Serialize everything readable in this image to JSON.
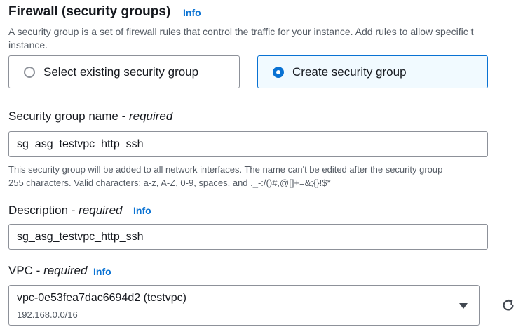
{
  "firewall": {
    "title": "Firewall (security groups)",
    "info": "Info",
    "description_line1": "A security group is a set of firewall rules that control the traffic for your instance. Add rules to allow specific t",
    "description_line2": "instance."
  },
  "options": {
    "existing_label": "Select existing security group",
    "create_label": "Create security group",
    "selected": "create"
  },
  "sg_name": {
    "label": "Security group name - ",
    "required": "required",
    "value": "sg_asg_testvpc_http_ssh",
    "hint_line1": "This security group will be added to all network interfaces. The name can't be edited after the security group",
    "hint_line2": "255 characters. Valid characters: a-z, A-Z, 0-9, spaces, and ._-:/()#,@[]+=&;{}!$*"
  },
  "description": {
    "label": "Description - ",
    "required": "required",
    "info": "Info",
    "value": "sg_asg_testvpc_http_ssh"
  },
  "vpc": {
    "label": "VPC - ",
    "required": "required",
    "info": "Info",
    "selected": "vpc-0e53fea7dac6694d2 (testvpc)",
    "cidr": "192.168.0.0/16"
  },
  "icons": {
    "caret": "caret-down-icon",
    "refresh": "refresh-icon"
  },
  "colors": {
    "accent": "#0972d3",
    "selected_tile_bg": "#f1faff",
    "border": "#8d9199",
    "text": "#16191f",
    "secondary_text": "#545b64"
  }
}
